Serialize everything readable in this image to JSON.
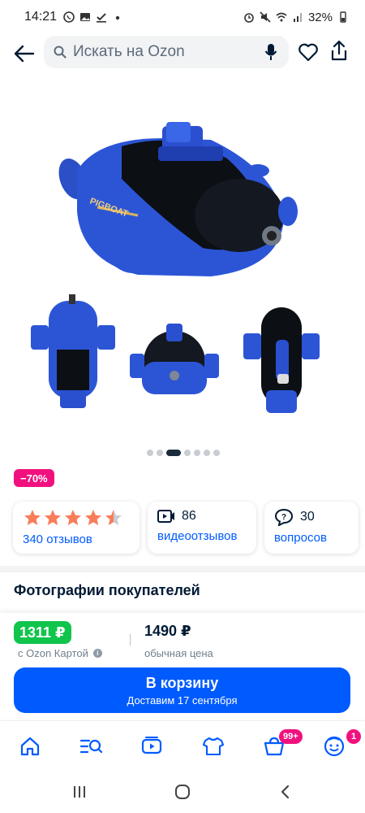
{
  "status_bar": {
    "time": "14:21",
    "battery": "32%"
  },
  "header": {
    "search_placeholder": "Искать на Ozon"
  },
  "gallery": {
    "dot_count": 7,
    "active_index": 2
  },
  "discount_badge": "−70%",
  "reviews_card": {
    "rating": 4.5,
    "reviews_link": "340 отзывов"
  },
  "video_card": {
    "count": "86",
    "link": "видеоотзывов"
  },
  "questions_card": {
    "count": "30",
    "link": "вопросов"
  },
  "photos_title": "Фотографии покупателей",
  "price": {
    "ozon_price": "1311 ₽",
    "ozon_card_label": "с Ozon Картой",
    "regular_price": "1490 ₽",
    "regular_label": "обычная цена"
  },
  "cart_button": {
    "label": "В корзину",
    "delivery": "Доставим 17 сентября"
  },
  "tabbar": {
    "cart_badge": "99+",
    "profile_badge": "1"
  },
  "colors": {
    "accent": "#005bff",
    "discount": "#f1117e",
    "ozon_price": "#10c44c",
    "star": "#f97d59"
  }
}
